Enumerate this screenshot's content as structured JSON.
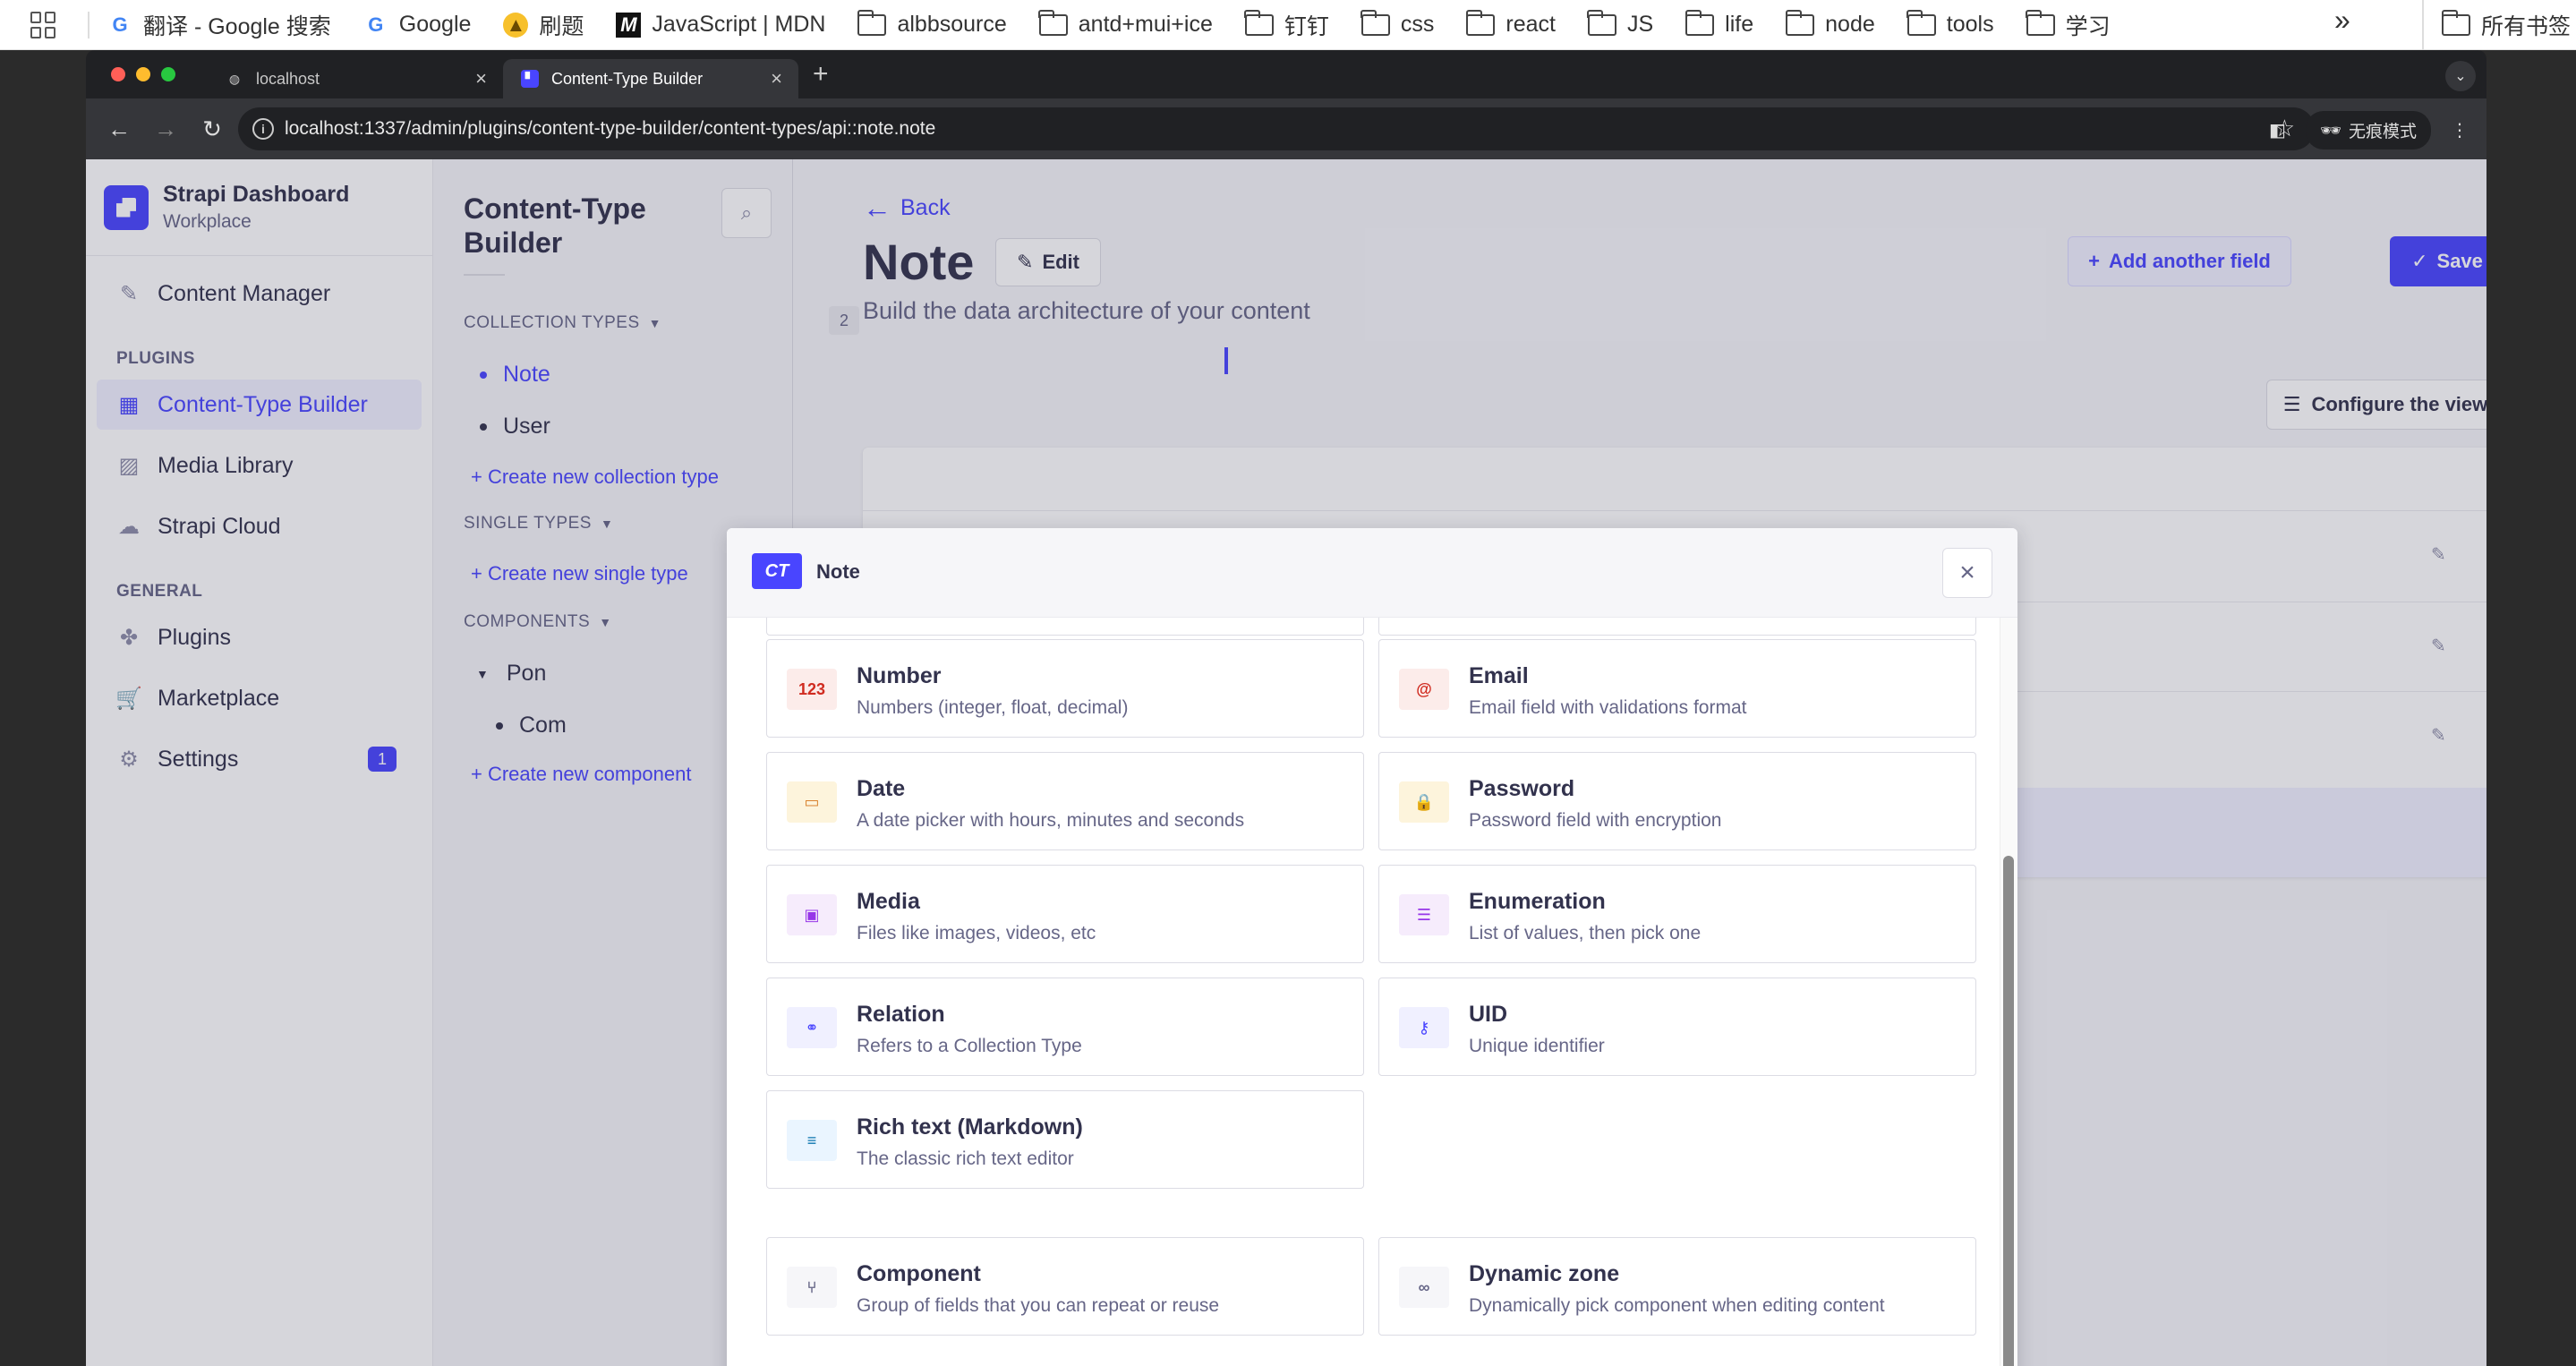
{
  "bookmarks": {
    "items": [
      {
        "label": "翻译 - Google 搜索",
        "icon": "google-icon"
      },
      {
        "label": "Google",
        "icon": "google-icon"
      },
      {
        "label": "刷题",
        "icon": "leetcode-icon"
      },
      {
        "label": "JavaScript | MDN",
        "icon": "mdn-icon"
      },
      {
        "label": "albbsource",
        "icon": "folder-icon"
      },
      {
        "label": "antd+mui+ice",
        "icon": "folder-icon"
      },
      {
        "label": "钉钉",
        "icon": "folder-icon"
      },
      {
        "label": "css",
        "icon": "folder-icon"
      },
      {
        "label": "react",
        "icon": "folder-icon"
      },
      {
        "label": "JS",
        "icon": "folder-icon"
      },
      {
        "label": "life",
        "icon": "folder-icon"
      },
      {
        "label": "node",
        "icon": "folder-icon"
      },
      {
        "label": "tools",
        "icon": "folder-icon"
      },
      {
        "label": "学习",
        "icon": "folder-icon"
      }
    ],
    "more": "»",
    "all_bookmarks": "所有书签"
  },
  "browser": {
    "tabs": [
      {
        "title": "localhost",
        "active": false
      },
      {
        "title": "Content-Type Builder",
        "active": true
      }
    ],
    "url": "localhost:1337/admin/plugins/content-type-builder/content-types/api::note.note",
    "incognito_label": "无痕模式"
  },
  "mainnav": {
    "brand_name": "Strapi Dashboard",
    "brand_sub": "Workplace",
    "content_manager": "Content Manager",
    "plugins_heading": "PLUGINS",
    "plugins": [
      {
        "label": "Content-Type Builder",
        "icon": "layout-icon",
        "active": true
      },
      {
        "label": "Media Library",
        "icon": "picture-icon",
        "active": false
      },
      {
        "label": "Strapi Cloud",
        "icon": "cloud-icon",
        "active": false
      }
    ],
    "general_heading": "GENERAL",
    "general": [
      {
        "label": "Plugins",
        "icon": "puzzle-icon"
      },
      {
        "label": "Marketplace",
        "icon": "cart-icon"
      },
      {
        "label": "Settings",
        "icon": "cog-icon",
        "badge": "1"
      }
    ]
  },
  "subnav": {
    "title": "Content-Type Builder",
    "collection_types_heading": "COLLECTION TYPES",
    "collection_count": "2",
    "collection_types": [
      "Note",
      "User"
    ],
    "create_collection": "Create new collection type",
    "single_types_heading": "SINGLE TYPES",
    "create_single": "Create new single type",
    "components_heading": "COMPONENTS",
    "component_category": "Pon",
    "components": [
      "Com"
    ],
    "create_component": "Create new component"
  },
  "header": {
    "back": "Back",
    "title": "Note",
    "edit": "Edit",
    "subtitle": "Build the data architecture of your content",
    "add_field": "Add another field",
    "save": "Save",
    "configure_view": "Configure the view"
  },
  "modal": {
    "badge": "CT",
    "title": "Note",
    "fields": [
      {
        "name": "Number",
        "desc": "Numbers (integer, float, decimal)",
        "icon": "number-icon",
        "glyph": "123",
        "color": "#d02b20",
        "bg": "#fcecea"
      },
      {
        "name": "Email",
        "desc": "Email field with validations format",
        "icon": "at-icon",
        "glyph": "@",
        "color": "#d02b20",
        "bg": "#fcecea"
      },
      {
        "name": "Date",
        "desc": "A date picker with hours, minutes and seconds",
        "icon": "calendar-icon",
        "glyph": "▭",
        "color": "#d9822f",
        "bg": "#fdf4dc"
      },
      {
        "name": "Password",
        "desc": "Password field with encryption",
        "icon": "lock-icon",
        "glyph": "🔒",
        "color": "#d9822f",
        "bg": "#fdf4dc"
      },
      {
        "name": "Media",
        "desc": "Files like images, videos, etc",
        "icon": "image-icon",
        "glyph": "▣",
        "color": "#9736e8",
        "bg": "#f6ecfc"
      },
      {
        "name": "Enumeration",
        "desc": "List of values, then pick one",
        "icon": "list-icon",
        "glyph": "☰",
        "color": "#9736e8",
        "bg": "#f6ecfc"
      },
      {
        "name": "Relation",
        "desc": "Refers to a Collection Type",
        "icon": "link-icon",
        "glyph": "⚭",
        "color": "#4945ff",
        "bg": "#f0f0ff"
      },
      {
        "name": "UID",
        "desc": "Unique identifier",
        "icon": "key-icon",
        "glyph": "⚷",
        "color": "#4945ff",
        "bg": "#f0f0ff"
      },
      {
        "name": "Rich text (Markdown)",
        "desc": "The classic rich text editor",
        "icon": "paragraph-icon",
        "glyph": "≡",
        "color": "#0c75af",
        "bg": "#eaf5ff"
      },
      {
        "name": "Component",
        "desc": "Group of fields that you can repeat or reuse",
        "icon": "component-icon",
        "glyph": "⑂",
        "color": "#666687",
        "bg": "#f6f6f9"
      },
      {
        "name": "Dynamic zone",
        "desc": "Dynamically pick component when editing content",
        "icon": "infinity-icon",
        "glyph": "∞",
        "color": "#666687",
        "bg": "#f6f6f9"
      }
    ]
  }
}
